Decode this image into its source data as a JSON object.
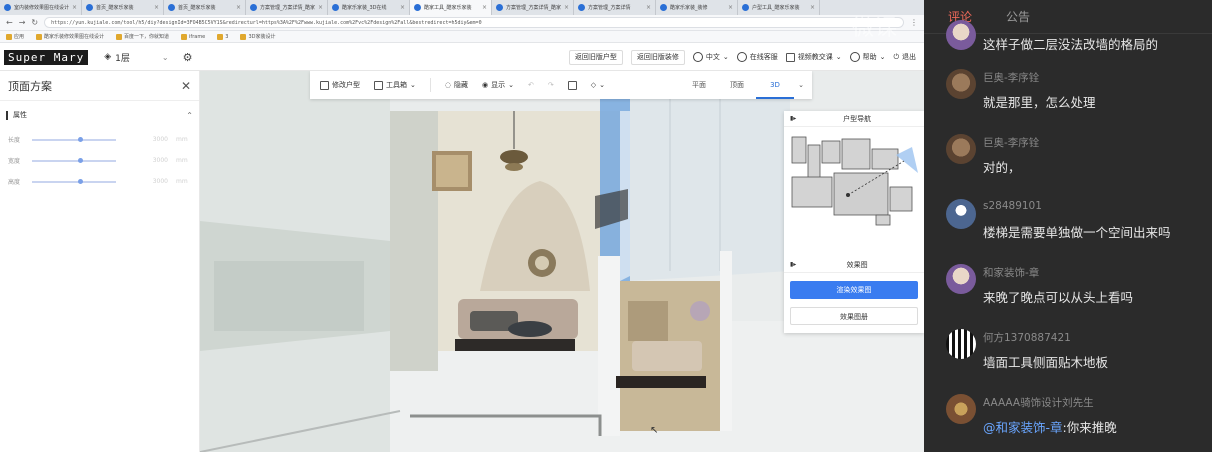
{
  "browser": {
    "tabs": [
      {
        "label": "室内装修效果图在线设计"
      },
      {
        "label": "首页_酷家乐家装"
      },
      {
        "label": "首页_酷家乐家装"
      },
      {
        "label": "方案管理_方案详情_酷家"
      },
      {
        "label": "酷家乐家装_3D在线"
      },
      {
        "label": "酷家工具_酷家乐家装"
      },
      {
        "label": "方案管理_方案详情_酷家"
      },
      {
        "label": "方案管理_方案详情"
      },
      {
        "label": "酷家乐家装_装修"
      },
      {
        "label": "户型工具_酷家乐家装"
      }
    ],
    "url": "https://yun.kujiale.com/tool/h5/diy?designId=3FO4B5C5VY1S&redirecturl=https%3A%2F%2Fwww.kujiale.com%2Fvc%2Fdesign%2Fall&bestredirect=h5diy&em=0",
    "bookmarks": [
      "应用",
      "酷家乐装修效果图在线设计",
      "百度一下，你就知道",
      "iframe",
      "3",
      "3D家装设计"
    ]
  },
  "app": {
    "logo": "Super Mary",
    "floor": "1层",
    "btn_back_floorplan": "返回旧版户型",
    "btn_back_decor": "返回旧版装修",
    "lang": "中文",
    "online_service": "在线客服",
    "video_tutorial": "视频教交课",
    "help": "帮助",
    "logout": "退出"
  },
  "left_panel": {
    "title": "顶面方案",
    "section": "属性",
    "sliders": [
      {
        "label": "长度",
        "value": "3000",
        "unit": "mm"
      },
      {
        "label": "宽度",
        "value": "3000",
        "unit": "mm"
      },
      {
        "label": "高度",
        "value": "3000",
        "unit": "mm"
      }
    ]
  },
  "viewport": {
    "tools": {
      "modify_floorplan": "修改户型",
      "toolbox": "工具箱",
      "hide": "隐藏",
      "display": "显示"
    },
    "view_tabs": [
      "平面",
      "顶面",
      "3D"
    ],
    "active_view": "3D",
    "minimap_title": "户型导航",
    "render_title": "效果图",
    "render_button": "渲染效果图",
    "album_button": "效果图册"
  },
  "chat": {
    "watermark": "微课",
    "tabs": [
      "评论",
      "公告"
    ],
    "active_tab": "评论",
    "messages": [
      {
        "user": "",
        "text": "这样子做二层没法改墙的格局的",
        "avatar": "cartoon"
      },
      {
        "user": "巨奥-李序铨",
        "text": "就是那里，怎么处理",
        "avatar": "brown"
      },
      {
        "user": "巨奥-李序铨",
        "text": "对的，",
        "avatar": "brown"
      },
      {
        "user": "s28489101",
        "text": "楼梯是需要单独做一个空间出来吗",
        "avatar": "default"
      },
      {
        "user": "和家装饰-章",
        "text": "来晚了晚点可以从头上看吗",
        "avatar": "cartoon"
      },
      {
        "user": "何方1370887421",
        "text": "墙面工具侧面贴木地板",
        "avatar": "qr"
      },
      {
        "user": "AAAAA骑饰设计刘先生",
        "mention": "@和家装饰-章",
        "text": ":你来推晚",
        "avatar": "flower"
      }
    ],
    "colors": {
      "accent": "#f06a5a",
      "mention": "#6aa6ff",
      "bg": "#2b2b2b"
    }
  }
}
